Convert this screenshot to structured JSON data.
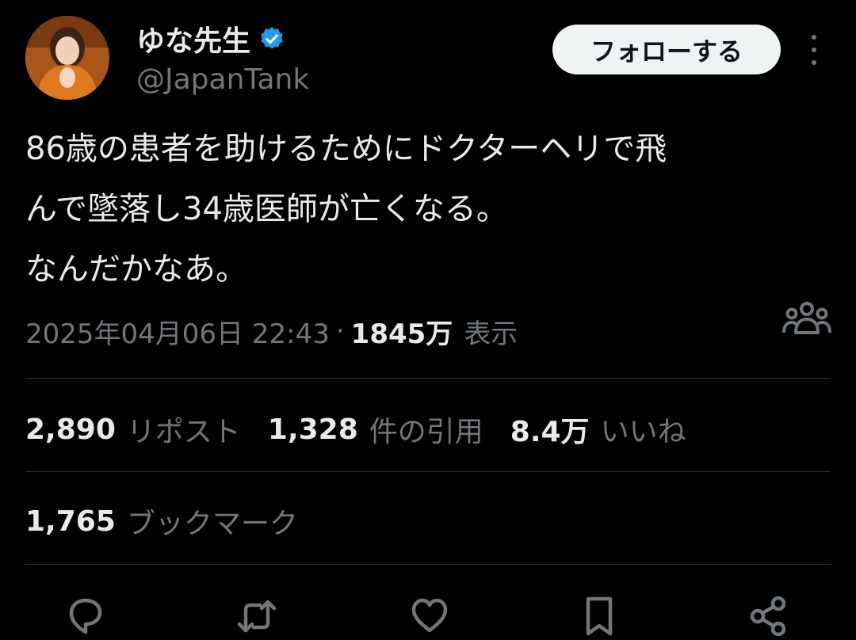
{
  "author": {
    "display_name": "ゆな先生",
    "handle": "@JapanTank",
    "verified_icon": "verified-badge-icon",
    "avatar_icon": "avatar"
  },
  "follow_button_label": "フォローする",
  "more_icon": "more-options-icon",
  "tweet": {
    "lines": [
      "86歳の患者を助けるためにドクターヘリで飛",
      "んで墜落し34歳医師が亡くなる。",
      "なんだかなあ。"
    ]
  },
  "meta": {
    "datetime": "2025年04月06日 22:43",
    "separator": "·",
    "views_count": "1845万",
    "views_label": "表示"
  },
  "stats": {
    "reposts": {
      "count": "2,890",
      "label": "リポスト"
    },
    "quotes": {
      "count": "1,328",
      "label": "件の引用"
    },
    "likes": {
      "count": "8.4万",
      "label": "いいね"
    },
    "bookmarks": {
      "count": "1,765",
      "label": "ブックマーク"
    }
  },
  "actions": [
    "reply-icon",
    "retweet-icon",
    "like-icon",
    "bookmark-icon",
    "share-icon"
  ],
  "colors": {
    "background": "#000000",
    "text": "#e7e9ea",
    "muted": "#71767b",
    "divider": "#2f3336",
    "verified": "#1d9bf0",
    "follow_bg": "#eff3f4"
  }
}
